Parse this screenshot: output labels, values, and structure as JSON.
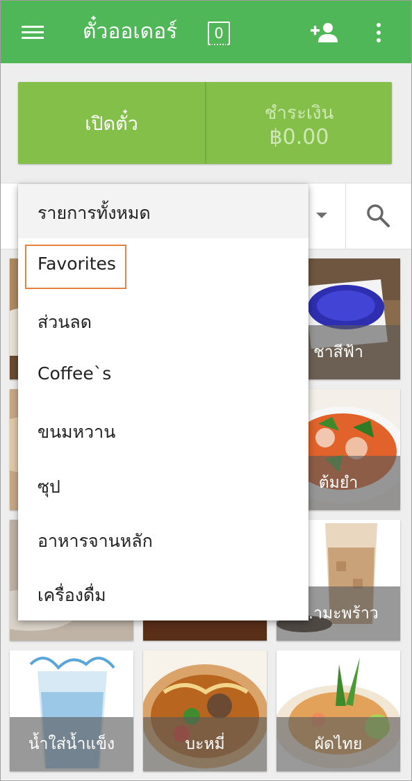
{
  "appbar": {
    "title": "ตั๋วออเดอร์",
    "ticket_count": "0",
    "icons": {
      "menu": "hamburger-menu-icon",
      "add_customer": "add-customer-icon",
      "more": "more-vert-icon"
    }
  },
  "actions": {
    "open_ticket": "เปิดตั๋ว",
    "charge_label": "ชำระเงิน",
    "charge_amount": "฿0.00"
  },
  "filter": {
    "selected": "รายการทั้งหมด",
    "search_icon": "search-icon"
  },
  "dropdown": {
    "items": [
      "Favorites",
      "ส่วนลด",
      "Coffee`s",
      "ขนมหวาน",
      "ซุป",
      "อาหารจานหลัก",
      "เครื่องดื่ม"
    ]
  },
  "tiles": [
    {
      "label": ""
    },
    {
      "label": ""
    },
    {
      "label": "ชาสีฟ้า"
    },
    {
      "label": ""
    },
    {
      "label": ""
    },
    {
      "label": "ต้มยำ"
    },
    {
      "label": ""
    },
    {
      "label": ""
    },
    {
      "label": "...ามะพร้าว"
    },
    {
      "label": "น้ำใส่น้ำแข็ง"
    },
    {
      "label": "บะหมี่"
    },
    {
      "label": "ผัดไทย"
    }
  ],
  "colors": {
    "appbar": "#4fb757",
    "action_button": "#84bf4a",
    "highlight_border": "#e8823a"
  }
}
